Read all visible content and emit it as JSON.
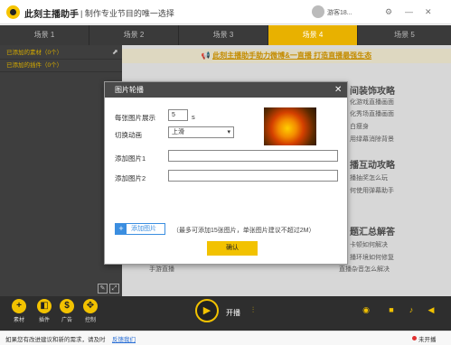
{
  "titlebar": {
    "app_name": "此刻主播助手",
    "slogan": "| 制作专业节目的唯一选择",
    "user_name": "游客18...",
    "icons": [
      "settings-icon",
      "minimize-icon",
      "close-icon"
    ]
  },
  "tabs": [
    "场景 1",
    "场景 2",
    "场景 3",
    "场景 4",
    "场景 5"
  ],
  "active_tab": "场景 4",
  "left_panel": {
    "materials": "已添加的素材（0个）",
    "plugins": "已添加的插件（0个）"
  },
  "banner": "此刻主播助手助力微博&一直播 打造直播最强生态",
  "guides": {
    "col1_title": "间装饰攻略",
    "col1_items": [
      "化游戏直播画面",
      "化秀场直播画面",
      "白瘦身",
      "用绿幕消除背景"
    ],
    "col2_title": "播互动攻略",
    "col2_items": [
      "播抽奖怎么玩",
      "何使用弹幕助手"
    ],
    "col3_title": "题汇总解答",
    "col3_items": [
      "卡顿如何解决",
      "播环境如何修复",
      "直播杂音怎么解决"
    ],
    "extra_item": "手游直播"
  },
  "dialog": {
    "title": "图片轮播",
    "per_image_label": "每张图片展示",
    "per_image_value": "5",
    "per_image_unit": "s",
    "anim_label": "切换动画",
    "anim_value": "上滑",
    "add1_label": "添加图片1",
    "add2_label": "添加图片2",
    "add_button": "添加图片",
    "hint": "（最多可添加15张图片，单张图片建议不超过2M）",
    "confirm": "确认"
  },
  "bottombar": {
    "buttons": [
      {
        "icon": "plus-icon",
        "label": "素材"
      },
      {
        "icon": "plugin-icon",
        "label": "插件"
      },
      {
        "icon": "ad-icon",
        "label": "广告"
      },
      {
        "icon": "control-icon",
        "label": "控制"
      }
    ],
    "start_label": "开播"
  },
  "status": {
    "text": "如果您有改进建议和新的需求，请及时",
    "link": "反馈我们",
    "live": "未开播"
  },
  "colors": {
    "accent": "#f2c200",
    "tab_active": "#e8b100",
    "link": "#2a6fd6"
  }
}
